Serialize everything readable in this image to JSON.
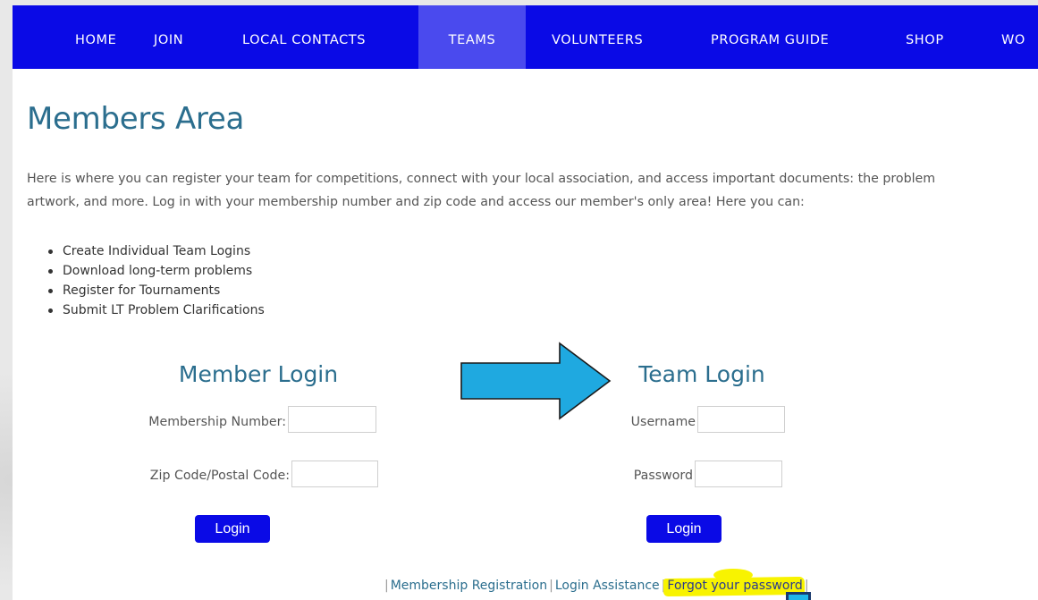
{
  "nav": {
    "items": [
      {
        "label": "HOME",
        "active": false
      },
      {
        "label": "JOIN",
        "active": false
      },
      {
        "label": "LOCAL CONTACTS",
        "active": false
      },
      {
        "label": "TEAMS",
        "active": true
      },
      {
        "label": "VOLUNTEERS",
        "active": false
      },
      {
        "label": "PROGRAM GUIDE",
        "active": false
      },
      {
        "label": "SHOP",
        "active": false
      },
      {
        "label": "WO",
        "active": false
      }
    ],
    "bg_color": "#0a0ae6",
    "active_bg_color": "#4a4aee"
  },
  "main": {
    "title": "Members Area",
    "intro_line1": "Here is where you can register your team for competitions, connect with your local association, and access important documents: the problem",
    "intro_line2": "artwork, and more. Log in with your membership number and zip code and access our member's only area! Here you can:",
    "bullets": [
      "Create Individual Team Logins",
      "Download long-term problems",
      "Register for Tournaments",
      "Submit LT Problem Clarifications"
    ]
  },
  "member_login": {
    "title": "Member Login",
    "membership_number_label": "Membership Number:",
    "membership_number_value": "",
    "zip_label": "Zip Code/Postal Code:",
    "zip_value": "",
    "button_label": "Login"
  },
  "team_login": {
    "title": "Team Login",
    "username_label": "Username",
    "username_value": "",
    "password_label": "Password",
    "password_value": "",
    "button_label": "Login"
  },
  "annotation": {
    "arrow_icon": "right-arrow-icon",
    "arrow_color": "#1fa9e0",
    "highlight_color": "#f8f300"
  },
  "footer": {
    "pipe": "|",
    "links": [
      "Membership Registration",
      "Login Assistance",
      "Forgot your password"
    ]
  }
}
